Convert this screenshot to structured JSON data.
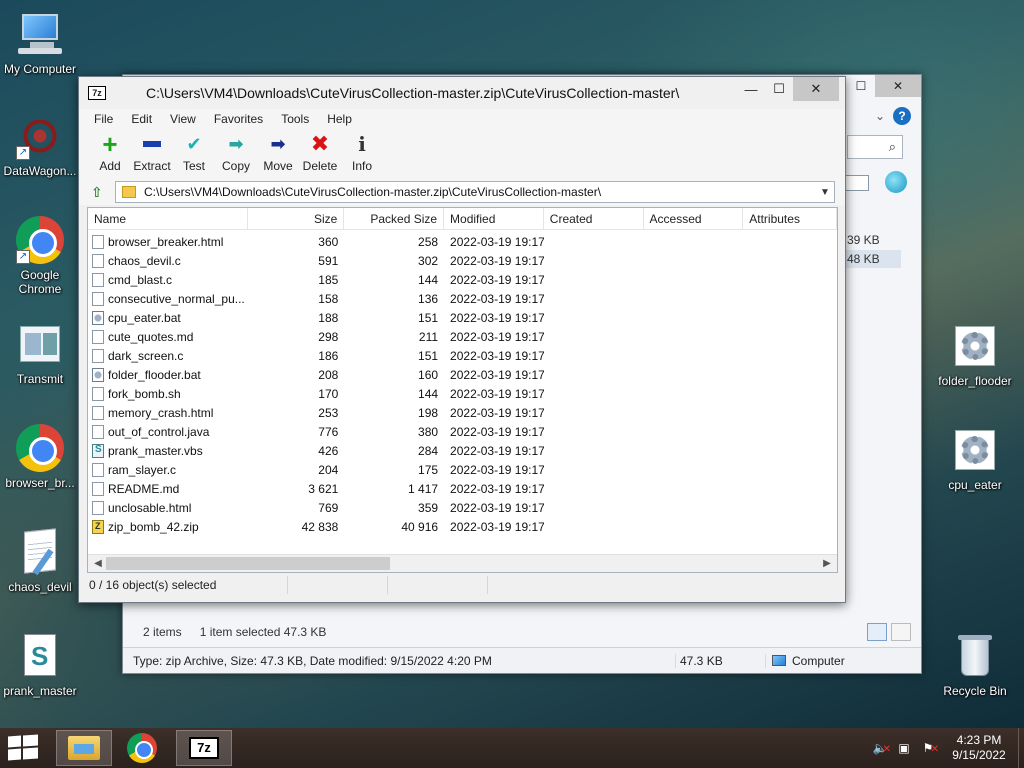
{
  "desktop": {
    "icons": [
      {
        "label": "My Computer",
        "icon": "computer-icon"
      },
      {
        "label": "DataWagon...",
        "icon": "datawagon-icon"
      },
      {
        "label": "Google Chrome",
        "icon": "chrome-icon"
      },
      {
        "label": "Transmit",
        "icon": "transmit-icon"
      },
      {
        "label": "browser_br...",
        "icon": "chrome-icon"
      },
      {
        "label": "chaos_devil",
        "icon": "notepad-icon"
      },
      {
        "label": "prank_master",
        "icon": "script-icon"
      },
      {
        "label": "folder_flooder",
        "icon": "gear-file-icon"
      },
      {
        "label": "cpu_eater",
        "icon": "gear-file-icon"
      },
      {
        "label": "Recycle Bin",
        "icon": "recycle-bin-icon"
      }
    ]
  },
  "explorer": {
    "visible_sizes": [
      "39 KB",
      "48 KB"
    ],
    "status_items": "2 items",
    "status_selected": "1 item selected  47.3 KB",
    "details_text": "Type: zip Archive, Size: 47.3 KB, Date modified: 9/15/2022 4:20 PM",
    "details_size": "47.3 KB",
    "details_location": "Computer",
    "help_label": "?"
  },
  "zip": {
    "title": "C:\\Users\\VM4\\Downloads\\CuteVirusCollection-master.zip\\CuteVirusCollection-master\\",
    "app_icon": "7z",
    "menu": [
      "File",
      "Edit",
      "View",
      "Favorites",
      "Tools",
      "Help"
    ],
    "toolbar": [
      {
        "label": "Add",
        "icon": "add-icon",
        "glyph": "+"
      },
      {
        "label": "Extract",
        "icon": "extract-icon",
        "glyph": ""
      },
      {
        "label": "Test",
        "icon": "test-icon",
        "glyph": "✔"
      },
      {
        "label": "Copy",
        "icon": "copy-icon",
        "glyph": "➡"
      },
      {
        "label": "Move",
        "icon": "move-icon",
        "glyph": "➡"
      },
      {
        "label": "Delete",
        "icon": "delete-icon",
        "glyph": "✖"
      },
      {
        "label": "Info",
        "icon": "info-icon",
        "glyph": "i"
      }
    ],
    "address": "C:\\Users\\VM4\\Downloads\\CuteVirusCollection-master.zip\\CuteVirusCollection-master\\",
    "columns": [
      "Name",
      "Size",
      "Packed Size",
      "Modified",
      "Created",
      "Accessed",
      "Attributes"
    ],
    "files": [
      {
        "name": "browser_breaker.html",
        "size": "360",
        "packed": "258",
        "modified": "2022-03-19 19:17",
        "type": "file"
      },
      {
        "name": "chaos_devil.c",
        "size": "591",
        "packed": "302",
        "modified": "2022-03-19 19:17",
        "type": "file"
      },
      {
        "name": "cmd_blast.c",
        "size": "185",
        "packed": "144",
        "modified": "2022-03-19 19:17",
        "type": "file"
      },
      {
        "name": "consecutive_normal_pu...",
        "size": "158",
        "packed": "136",
        "modified": "2022-03-19 19:17",
        "type": "file"
      },
      {
        "name": "cpu_eater.bat",
        "size": "188",
        "packed": "151",
        "modified": "2022-03-19 19:17",
        "type": "bat"
      },
      {
        "name": "cute_quotes.md",
        "size": "298",
        "packed": "211",
        "modified": "2022-03-19 19:17",
        "type": "file"
      },
      {
        "name": "dark_screen.c",
        "size": "186",
        "packed": "151",
        "modified": "2022-03-19 19:17",
        "type": "file"
      },
      {
        "name": "folder_flooder.bat",
        "size": "208",
        "packed": "160",
        "modified": "2022-03-19 19:17",
        "type": "bat"
      },
      {
        "name": "fork_bomb.sh",
        "size": "170",
        "packed": "144",
        "modified": "2022-03-19 19:17",
        "type": "file"
      },
      {
        "name": "memory_crash.html",
        "size": "253",
        "packed": "198",
        "modified": "2022-03-19 19:17",
        "type": "file"
      },
      {
        "name": "out_of_control.java",
        "size": "776",
        "packed": "380",
        "modified": "2022-03-19 19:17",
        "type": "file"
      },
      {
        "name": "prank_master.vbs",
        "size": "426",
        "packed": "284",
        "modified": "2022-03-19 19:17",
        "type": "vbs"
      },
      {
        "name": "ram_slayer.c",
        "size": "204",
        "packed": "175",
        "modified": "2022-03-19 19:17",
        "type": "file"
      },
      {
        "name": "README.md",
        "size": "3 621",
        "packed": "1 417",
        "modified": "2022-03-19 19:17",
        "type": "file"
      },
      {
        "name": "unclosable.html",
        "size": "769",
        "packed": "359",
        "modified": "2022-03-19 19:17",
        "type": "file"
      },
      {
        "name": "zip_bomb_42.zip",
        "size": "42 838",
        "packed": "40 916",
        "modified": "2022-03-19 19:17",
        "type": "zip"
      }
    ],
    "status": "0 / 16 object(s) selected"
  },
  "taskbar": {
    "apps": [
      {
        "name": "file-explorer",
        "icon": "folder-icon"
      },
      {
        "name": "chrome",
        "icon": "chrome-icon"
      },
      {
        "name": "7zip",
        "icon": "7zip-icon",
        "label": "7z"
      }
    ],
    "time": "4:23 PM",
    "date": "9/15/2022"
  }
}
